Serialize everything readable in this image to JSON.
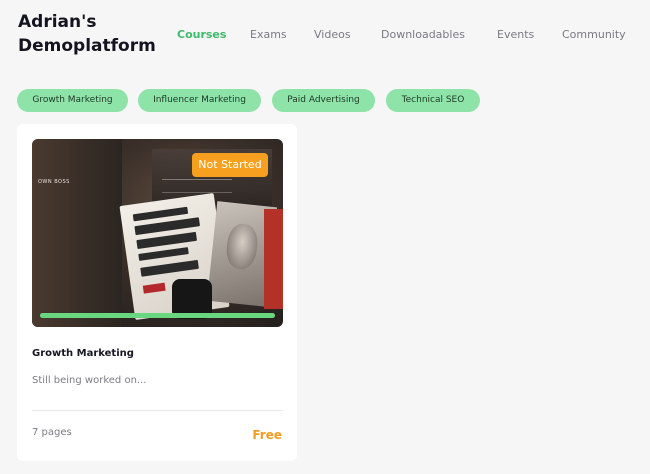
{
  "header": {
    "brand_line1": "Adrian's",
    "brand_line2": "Demoplatform",
    "nav": [
      {
        "label": "Courses",
        "active": true
      },
      {
        "label": "Exams",
        "active": false
      },
      {
        "label": "Videos",
        "active": false
      },
      {
        "label": "Downloadables",
        "active": false
      },
      {
        "label": "Events",
        "active": false
      },
      {
        "label": "Community",
        "active": false
      }
    ]
  },
  "tags": [
    {
      "label": "Growth Marketing"
    },
    {
      "label": "Influencer Marketing"
    },
    {
      "label": "Paid Advertising"
    },
    {
      "label": "Technical SEO"
    }
  ],
  "course": {
    "thumbnail_text": "OWN BOSS",
    "status_badge": "Not Started",
    "progress": 1.0,
    "title": "Growth Marketing",
    "description": "Still being worked on...",
    "pages": "7 pages",
    "price": "Free"
  },
  "colors": {
    "accent_green": "#3fba6a",
    "tag_bg": "#8ee3a8",
    "badge_orange": "#f7a020",
    "price_orange": "#f39c1f",
    "progress_green": "#68d77f"
  }
}
